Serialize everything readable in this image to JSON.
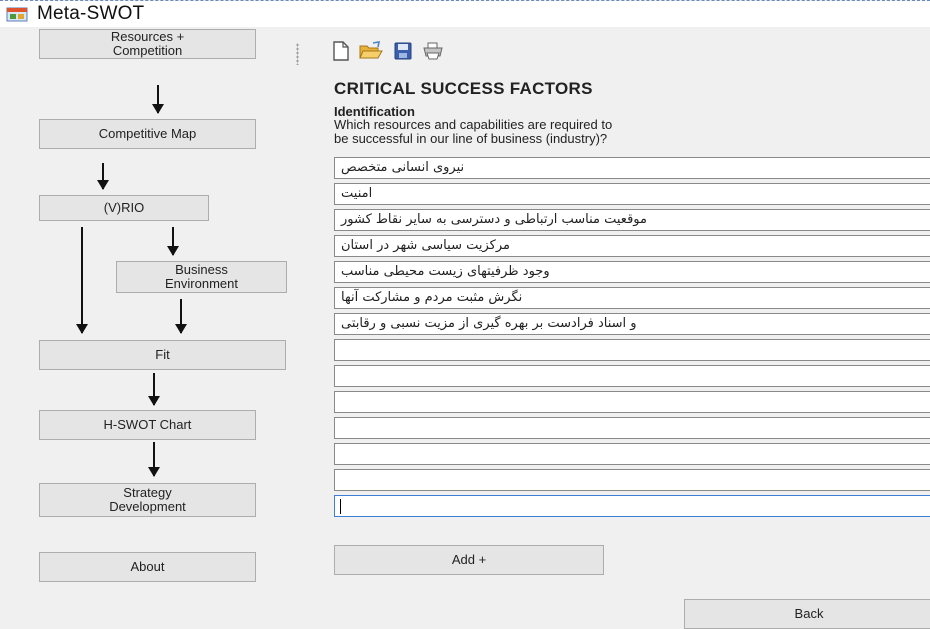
{
  "window": {
    "title": "Meta-SWOT"
  },
  "nav": {
    "resources_competition": [
      "Resources +",
      "Competition"
    ],
    "competitive_map": "Competitive Map",
    "vrio": "(V)RIO",
    "business_environment": [
      "Business",
      "Environment"
    ],
    "fit": "Fit",
    "hswot_chart": "H-SWOT Chart",
    "strategy_development": [
      "Strategy",
      "Development"
    ],
    "about": "About"
  },
  "toolbar": {
    "icons": [
      "new-document-icon",
      "open-folder-icon",
      "save-disk-icon",
      "print-icon"
    ]
  },
  "content": {
    "heading": "CRITICAL SUCCESS FACTORS",
    "subheading": "Identification",
    "description_line1": "Which resources and capabilities are required to",
    "description_line2": "be successful in our line of business (industry)?",
    "factors": [
      "نیروی انسانی متخصص",
      "امنیت",
      "موقعیت مناسب ارتباطی و دسترسی به سایر نقاط کشور",
      "مرکزیت سیاسی شهر در استان",
      "وجود ظرفیتهای زیست محیطی مناسب",
      "نگرش مثبت مردم و مشارکت آنها",
      "و اسناد فرادست بر بهره گیری از مزیت نسبی و رقابتی",
      "",
      "",
      "",
      "",
      "",
      "",
      ""
    ],
    "add_label": "Add +",
    "back_label": "Back"
  },
  "colors": {
    "window_bg": "#f0f0f0",
    "button_bg": "#e5e5e5",
    "active_border": "#3c7fd6"
  }
}
